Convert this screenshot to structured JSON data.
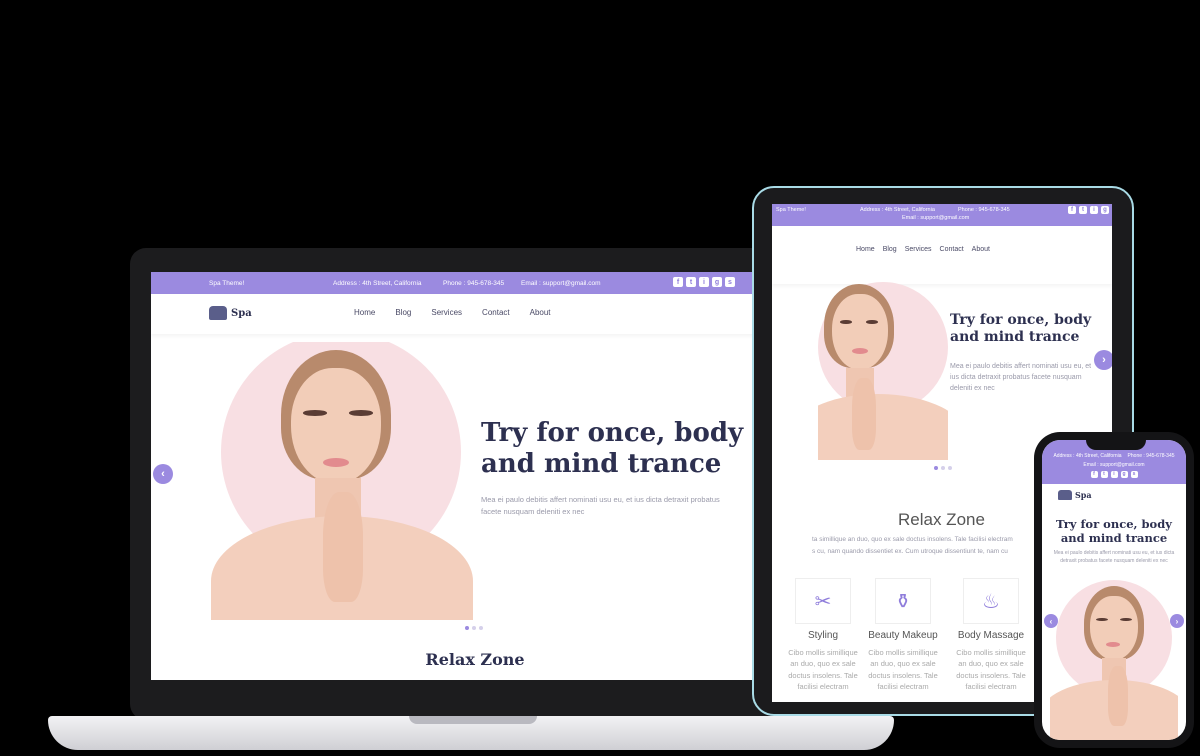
{
  "brand": {
    "name": "Spa"
  },
  "topbar": {
    "theme": "Spa Theme!",
    "address": "Address : 4th Street, California",
    "phone": "Phone : 945-678-345",
    "email": "Email : support@gmail.com",
    "tablet_theme": "Spa Theme!",
    "phone_address": "Address : 4th Street, California",
    "phone_phone": "Phone : 945-678-345"
  },
  "social": [
    "f",
    "t",
    "i",
    "g",
    "s"
  ],
  "nav": [
    "Home",
    "Blog",
    "Services",
    "Contact",
    "About"
  ],
  "hero": {
    "title_line1": "Try for once, body",
    "title_line2": "and mind trance",
    "text": "Mea ei paulo debitis affert nominati usu eu, et ius dicta detraxit probatus facete nusquam deleniti ex nec",
    "slide_index": 1,
    "slide_count": 3
  },
  "relax": {
    "title": "Relax Zone",
    "text_line1": "ta simillique an duo, quo ex sale doctus insolens. Tale facilisi electram",
    "text_line2": "s cu, nam quando dissentiet ex. Cum utroque dissentiunt te, nam cu"
  },
  "services": [
    {
      "title": "Styling",
      "desc": "Cibo mollis simillique an duo, quo ex sale doctus insolens. Tale facilisi electram"
    },
    {
      "title": "Beauty Makeup",
      "desc": "Cibo mollis simillique an duo, quo ex sale doctus insolens. Tale facilisi electram"
    },
    {
      "title": "Body Massage",
      "desc": "Cibo mollis simillique an duo, quo ex sale doctus insolens. Tale facilisi electram"
    }
  ],
  "icons": {
    "prev": "chevron-left-icon",
    "next": "chevron-right-icon",
    "logo": "spa-stones-icon",
    "makeup": "cosmetics-icon",
    "massage": "massage-icon",
    "styling": "hair-styling-icon"
  },
  "colors": {
    "accent": "#9b8ae0",
    "heading": "#2d3050",
    "blush": "#f8dfe3"
  }
}
